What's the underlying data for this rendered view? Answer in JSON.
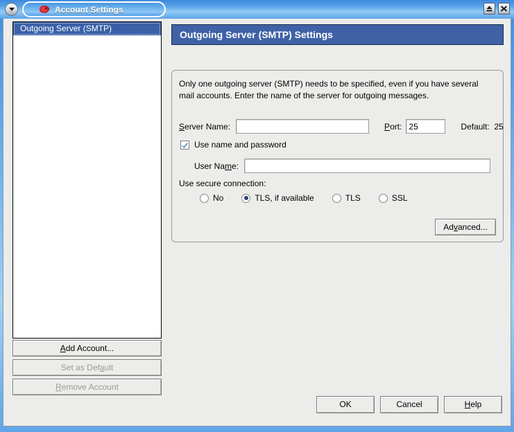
{
  "window": {
    "title": "Account Settings",
    "icon": "thunderbird-icon",
    "menu_button_icon": "chevron-down-icon",
    "maximize_icon": "eject-icon",
    "close_icon": "close-icon",
    "frame_color": "#4a97e3"
  },
  "sidebar": {
    "items": [
      {
        "label": "Outgoing Server (SMTP)",
        "selected": true
      }
    ],
    "buttons": [
      {
        "label": "Add Account...",
        "accel": "A",
        "disabled": false
      },
      {
        "label": "Set as Default",
        "accel": "a",
        "disabled": true
      },
      {
        "label": "Remove Account",
        "accel": "R",
        "disabled": true
      }
    ]
  },
  "panel": {
    "header": "Outgoing Server (SMTP) Settings",
    "header_color": "#3f62a6",
    "description": "Only one outgoing server (SMTP) needs to be specified, even if you have several mail accounts. Enter the name of the server for outgoing messages.",
    "server_name": {
      "label_pre": "S",
      "label_post": "erver Name:",
      "value": "",
      "placeholder": ""
    },
    "port": {
      "label_pre": "P",
      "label_post": "ort:",
      "value": "25",
      "default_label": "Default:",
      "default_value": "25"
    },
    "use_name_password": {
      "label": "Use name and password",
      "checked": true
    },
    "user_name": {
      "label_pre": "User Na",
      "label_accel": "m",
      "label_post": "e:",
      "value": "",
      "placeholder": ""
    },
    "secure_connection": {
      "label": "Use secure connection:",
      "options": [
        {
          "label": "No",
          "selected": false
        },
        {
          "label": "TLS, if available",
          "selected": true
        },
        {
          "label": "TLS",
          "selected": false
        },
        {
          "label": "SSL",
          "selected": false
        }
      ]
    },
    "advanced_button": {
      "label_pre": "Ad",
      "label_accel": "v",
      "label_post": "anced..."
    }
  },
  "dialog_buttons": [
    {
      "label": "OK",
      "accel": ""
    },
    {
      "label": "Cancel",
      "accel": ""
    },
    {
      "label": "Help",
      "accel": "H"
    }
  ]
}
